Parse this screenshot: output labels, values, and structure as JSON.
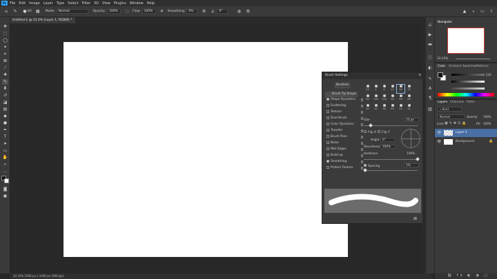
{
  "menubar": {
    "items": [
      "File",
      "Edit",
      "Image",
      "Layer",
      "Type",
      "Select",
      "Filter",
      "3D",
      "View",
      "Plugins",
      "Window",
      "Help"
    ]
  },
  "options": {
    "size": "60",
    "mode_label": "Mode:",
    "mode_value": "Normal",
    "opacity_label": "Opacity:",
    "opacity_value": "100%",
    "flow_label": "Flow:",
    "flow_value": "100%",
    "smoothing_label": "Smoothing:",
    "smoothing_value": "0%",
    "angle_value": "0°"
  },
  "document": {
    "tab_title": "Untitled-1 @ 33.3% (Layer 1, RGB/8) *",
    "status": "33.33%     2560 px x 1440 px (300 ppi)"
  },
  "brush_settings": {
    "title": "Brush Settings",
    "brushes_button": "Brushes",
    "tip_shape": "Brush Tip Shape",
    "options": [
      {
        "label": "Shape Dynamics",
        "checked": true
      },
      {
        "label": "Scattering",
        "checked": false
      },
      {
        "label": "Texture",
        "checked": false
      },
      {
        "label": "Dual Brush",
        "checked": false
      },
      {
        "label": "Color Dynamics",
        "checked": false
      },
      {
        "label": "Transfer",
        "checked": false
      },
      {
        "label": "Brush Pose",
        "checked": false
      },
      {
        "label": "Noise",
        "checked": false
      },
      {
        "label": "Wet Edges",
        "checked": false
      },
      {
        "label": "Build-up",
        "checked": false
      },
      {
        "label": "Smoothing",
        "checked": true
      },
      {
        "label": "Protect Texture",
        "checked": false
      }
    ],
    "tips_row1": [
      "25",
      "4",
      "8",
      "12",
      "25",
      "25"
    ],
    "tips_row2": [
      "50",
      "100",
      "100",
      "30",
      "50",
      "60"
    ],
    "tips_row3": [
      "42",
      "41",
      "36",
      "49",
      "25",
      "31"
    ],
    "size_label": "Size",
    "size_value": "25 px",
    "flip_x": "Flip X",
    "flip_y": "Flip Y",
    "angle_label": "Angle:",
    "angle_value": "0°",
    "roundness_label": "Roundness:",
    "roundness_value": "100%",
    "hardness_label": "Hardness",
    "hardness_value": "100%",
    "spacing_label": "Spacing",
    "spacing_value": "1%"
  },
  "navigator": {
    "title": "Navigator",
    "zoom": "33.33%"
  },
  "color": {
    "tabs": [
      "Color",
      "Gradient",
      "Swatches",
      "Patterns"
    ],
    "values": [
      "220",
      "",
      "",
      ""
    ]
  },
  "layers": {
    "tabs": [
      "Layers",
      "Channels",
      "Paths"
    ],
    "kind": "Kind",
    "blend": "Normal",
    "opacity_label": "Opacity:",
    "opacity_value": "100%",
    "lock_label": "Lock:",
    "fill_label": "Fill:",
    "fill_value": "100%",
    "items": [
      {
        "name": "Layer 1",
        "selected": true
      },
      {
        "name": "Background",
        "selected": false
      }
    ]
  },
  "colors": {
    "accent": "#31a8ff",
    "canvas": "#ffffff",
    "workspace": "#282828",
    "panel": "#3a3a3a",
    "selection": "#4a6fa5"
  },
  "icons": [
    "photoshop-logo",
    "home-icon",
    "brush-icon",
    "lock-icon",
    "search-icon"
  ]
}
